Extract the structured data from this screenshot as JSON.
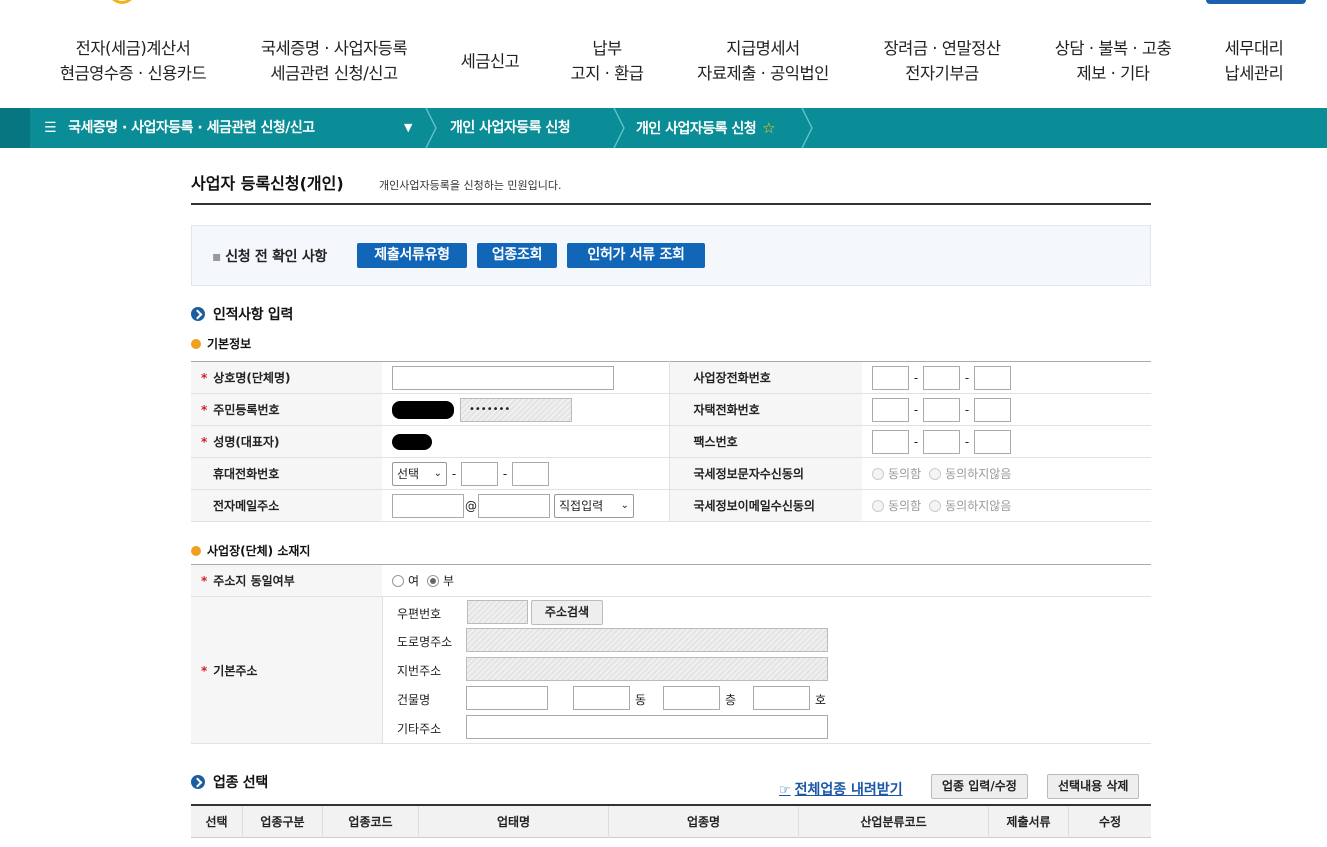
{
  "nav": {
    "items": [
      {
        "line1": "전자(세금)계산서",
        "line2": "현금영수증 · 신용카드"
      },
      {
        "line1": "국세증명 · 사업자등록",
        "line2": "세금관련 신청/신고"
      },
      {
        "line1": "세금신고",
        "line2": ""
      },
      {
        "line1": "납부",
        "line2": "고지 · 환급"
      },
      {
        "line1": "지급명세서",
        "line2": "자료제출 · 공익법인"
      },
      {
        "line1": "장려금 · 연말정산",
        "line2": "전자기부금"
      },
      {
        "line1": "상담 · 불복 · 고충",
        "line2": "제보 · 기타"
      },
      {
        "line1": "세무대리",
        "line2": "납세관리"
      }
    ]
  },
  "breadcrumb": {
    "menu": "국세증명 · 사업자등록 · 세금관련 신청/신고",
    "level2": "개인 사업자등록 신청",
    "level3": "개인 사업자등록 신청"
  },
  "page": {
    "title": "사업자 등록신청(개인)",
    "desc": "개인사업자등록을 신청하는 민원입니다."
  },
  "precheck": {
    "label": "신청 전 확인 사항",
    "buttons": [
      "제출서류유형",
      "업종조회",
      "인허가 서류 조회"
    ]
  },
  "personal": {
    "section_title": "인적사항 입력",
    "basic_title": "기본정보",
    "rows": {
      "company": "상호명(단체명)",
      "rrn": "주민등록번호",
      "name": "성명(대표자)",
      "mobile": "휴대전화번호",
      "email": "전자메일주소",
      "biz_phone": "사업장전화번호",
      "home_phone": "자택전화번호",
      "fax": "팩스번호",
      "sms_consent": "국세정보문자수신동의",
      "email_consent": "국세정보이메일수신동의"
    },
    "rrn_masked": "•••••••",
    "mobile_select": "선택",
    "email_domain_select": "직접입력",
    "email_at": "@",
    "agree": "동의함",
    "disagree": "동의하지않음"
  },
  "location": {
    "title": "사업장(단체) 소재지",
    "same_addr_label": "주소지 동일여부",
    "yes": "여",
    "no": "부",
    "base_addr_label": "기본주소",
    "zip": "우편번호",
    "search_btn": "주소검색",
    "road": "도로명주소",
    "lot": "지번주소",
    "building": "건물명",
    "dong": "동",
    "floor": "층",
    "ho": "호",
    "etc": "기타주소"
  },
  "industry": {
    "title": "업종 선택",
    "download": "전체업종 내려받기",
    "input_btn": "업종 입력/수정",
    "delete_btn": "선택내용 삭제",
    "columns": [
      "선택",
      "업종구분",
      "업종코드",
      "업태명",
      "업종명",
      "산업분류코드",
      "제출서류",
      "수정"
    ]
  },
  "colors": {
    "teal": "#0a8d96",
    "blue_btn": "#1166b8",
    "required": "#d02020"
  }
}
